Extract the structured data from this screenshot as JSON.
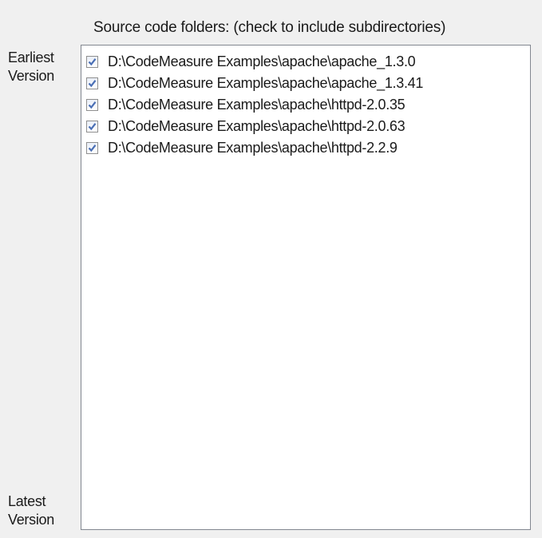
{
  "header": {
    "label": "Source code folders: (check to include subdirectories)"
  },
  "side_labels": {
    "earliest_line1": "Earliest",
    "earliest_line2": "Version",
    "latest_line1": "Latest",
    "latest_line2": "Version"
  },
  "folders": [
    {
      "path": "D:\\CodeMeasure Examples\\apache\\apache_1.3.0",
      "checked": true
    },
    {
      "path": "D:\\CodeMeasure Examples\\apache\\apache_1.3.41",
      "checked": true
    },
    {
      "path": "D:\\CodeMeasure Examples\\apache\\httpd-2.0.35",
      "checked": true
    },
    {
      "path": "D:\\CodeMeasure Examples\\apache\\httpd-2.0.63",
      "checked": true
    },
    {
      "path": "D:\\CodeMeasure Examples\\apache\\httpd-2.2.9",
      "checked": true
    }
  ],
  "colors": {
    "check_mark": "#4a6fb5",
    "list_border": "#828790",
    "panel_bg": "#f0f0f0"
  }
}
